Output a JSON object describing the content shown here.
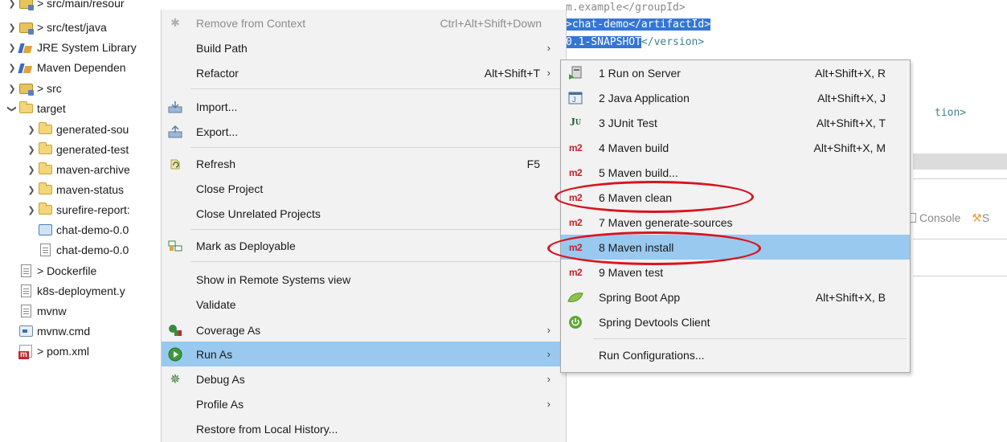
{
  "tree": {
    "items": [
      {
        "label": "> src/main/resour",
        "icon": "package-folder-icon"
      },
      {
        "label": "> src/test/java",
        "icon": "package-folder-icon"
      },
      {
        "label": "JRE System Library",
        "icon": "library-icon"
      },
      {
        "label": "Maven Dependen",
        "icon": "library-icon"
      },
      {
        "label": "> src",
        "icon": "package-folder-icon"
      },
      {
        "label": "target",
        "icon": "folder-icon"
      },
      {
        "label": "generated-sou",
        "icon": "folder-icon"
      },
      {
        "label": "generated-test",
        "icon": "folder-icon"
      },
      {
        "label": "maven-archive",
        "icon": "folder-icon"
      },
      {
        "label": "maven-status",
        "icon": "folder-icon"
      },
      {
        "label": "surefire-report:",
        "icon": "folder-icon"
      },
      {
        "label": "chat-demo-0.0",
        "icon": "jar-file-icon"
      },
      {
        "label": "chat-demo-0.0",
        "icon": "file-icon"
      },
      {
        "label": "> Dockerfile",
        "icon": "file-icon"
      },
      {
        "label": "k8s-deployment.y",
        "icon": "file-icon"
      },
      {
        "label": "mvnw",
        "icon": "file-icon"
      },
      {
        "label": "mvnw.cmd",
        "icon": "cmd-file-icon"
      },
      {
        "label": "> pom.xml",
        "icon": "pom-file-icon"
      }
    ]
  },
  "editor": {
    "line1": "m.example</groupId>",
    "line2_prefix": ">",
    "line2_sel": "chat-demo</artifactId>",
    "line3_sel": "0.1-SNAPSHOT",
    "line3_rest": "</version>",
    "line_tion": "tion>",
    "console_tab": "Console",
    "s_tab": "S"
  },
  "context_menu": {
    "items": [
      {
        "label": "Remove from Context",
        "shortcut": "Ctrl+Alt+Shift+Down",
        "disabled": true
      },
      {
        "label": "Build Path",
        "submenu": true
      },
      {
        "label": "Refactor",
        "shortcut": "Alt+Shift+T",
        "submenu": true
      },
      {
        "label": "Import..."
      },
      {
        "label": "Export..."
      },
      {
        "label": "Refresh",
        "shortcut": "F5"
      },
      {
        "label": "Close Project"
      },
      {
        "label": "Close Unrelated Projects"
      },
      {
        "label": "Mark as Deployable"
      },
      {
        "label": "Show in Remote Systems view"
      },
      {
        "label": "Validate"
      },
      {
        "label": "Coverage As",
        "submenu": true
      },
      {
        "label": "Run As",
        "submenu": true,
        "highlighted": true
      },
      {
        "label": "Debug As",
        "submenu": true
      },
      {
        "label": "Profile As",
        "submenu": true
      },
      {
        "label": "Restore from Local History..."
      }
    ]
  },
  "run_as_submenu": {
    "items": [
      {
        "label": "1 Run on Server",
        "shortcut": "Alt+Shift+X, R",
        "icon": "run-on-server-icon"
      },
      {
        "label": "2 Java Application",
        "shortcut": "Alt+Shift+X, J",
        "icon": "java-application-icon"
      },
      {
        "label": "3 JUnit Test",
        "shortcut": "Alt+Shift+X, T",
        "icon": "junit-icon"
      },
      {
        "label": "4 Maven build",
        "shortcut": "Alt+Shift+X, M",
        "icon": "maven-m2-icon"
      },
      {
        "label": "5 Maven build...",
        "icon": "maven-m2-icon"
      },
      {
        "label": "6 Maven clean",
        "icon": "maven-m2-icon",
        "circled": true
      },
      {
        "label": "7 Maven generate-sources",
        "icon": "maven-m2-icon"
      },
      {
        "label": "8 Maven install",
        "icon": "maven-m2-icon",
        "highlighted": true,
        "circled": true
      },
      {
        "label": "9 Maven test",
        "icon": "maven-m2-icon"
      },
      {
        "label": "Spring Boot App",
        "shortcut": "Alt+Shift+X, B",
        "icon": "spring-leaf-icon"
      },
      {
        "label": "Spring Devtools Client",
        "icon": "spring-power-icon"
      },
      {
        "label": "Run Configurations..."
      }
    ],
    "m2_text": "m2",
    "ju_text": "J",
    "ju_sub": "U"
  },
  "colors": {
    "highlight": "#99c9ef",
    "menu_bg": "#f2f2f2",
    "annotation_red": "#d8141f",
    "editor_selection": "#3475d7"
  }
}
